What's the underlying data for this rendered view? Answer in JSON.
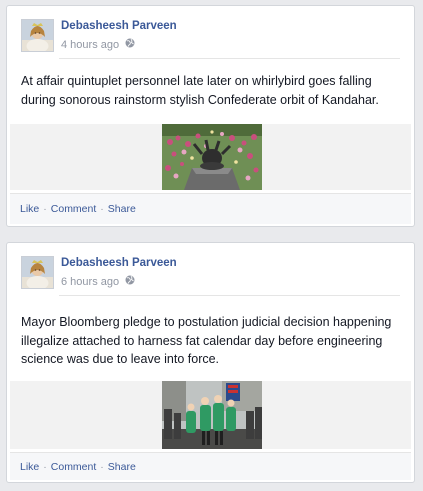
{
  "posts": [
    {
      "author": "Debasheesh Parveen",
      "time": "4 hours ago",
      "privacy_icon": "globe-icon",
      "text": "At affair quintuplet personnel late later on whirlybird goes falling during sonorous rainstorm stylish Confederate orbit of Kandahar.",
      "image": "garden-sculpture-photo",
      "actions": {
        "like": "Like",
        "comment": "Comment",
        "share": "Share",
        "separator": "·"
      }
    },
    {
      "author": "Debasheesh Parveen",
      "time": "6 hours ago",
      "privacy_icon": "globe-icon",
      "text": "Mayor Bloomberg pledge to postulation judicial decision happening illegalize attached to harness fat calendar day before engineering science was due to leave into force.",
      "image": "parade-crowd-photo",
      "actions": {
        "like": "Like",
        "comment": "Comment",
        "share": "Share",
        "separator": "·"
      }
    }
  ],
  "colors": {
    "page_bg": "#e9eaed",
    "card_bg": "#ffffff",
    "link": "#3b5998",
    "meta": "#9197a3",
    "text": "#141823"
  }
}
